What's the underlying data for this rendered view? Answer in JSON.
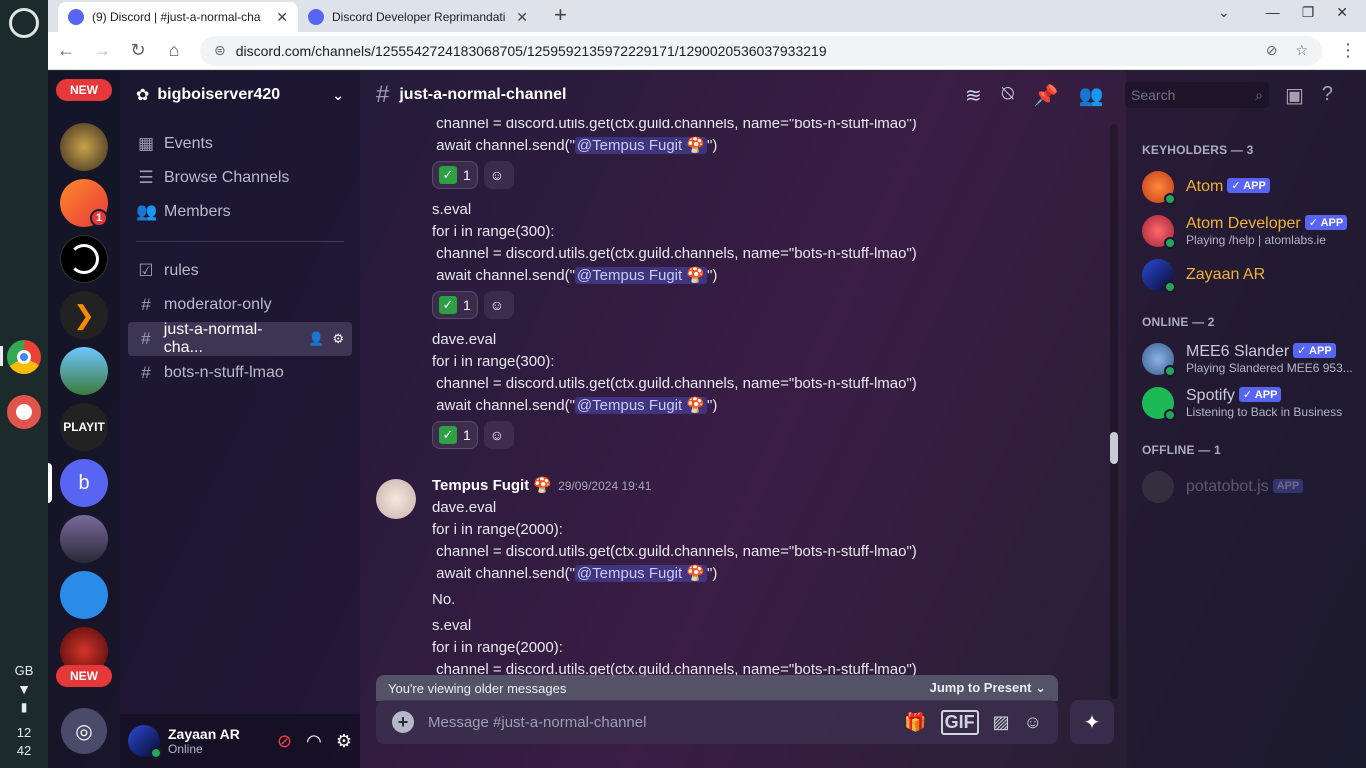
{
  "shelf": {
    "time_hours": "12",
    "time_minutes": "42",
    "keyboard": "GB"
  },
  "browser": {
    "tabs": [
      {
        "title": "(9) Discord | #just-a-normal-cha"
      },
      {
        "title": "Discord Developer Reprimandati"
      }
    ],
    "url": "discord.com/channels/1255542724183068705/1259592135972229171/1290020536037933219"
  },
  "guilds": {
    "new_label_top": "NEW",
    "new_label_bottom": "NEW",
    "notif_count": "1",
    "playit_label": "PLAYIT",
    "letter_server": "b"
  },
  "channels": {
    "server_name": "bigboiserver420",
    "top_items": [
      {
        "label": "Events"
      },
      {
        "label": "Browse Channels"
      },
      {
        "label": "Members"
      }
    ],
    "items": [
      {
        "label": "rules"
      },
      {
        "label": "moderator-only"
      },
      {
        "label": "just-a-normal-cha..."
      },
      {
        "label": "bots-n-stuff-lmao"
      }
    ]
  },
  "user": {
    "name": "Zayaan AR",
    "status": "Online"
  },
  "chat": {
    "channel_name": "just-a-normal-channel",
    "search_placeholder": "Search",
    "lines": [
      {
        "text": "channel = discord.utils.get(ctx.guild.channels, name=\"bots-n-stuff-lmao\")"
      },
      {
        "pre": "await channel.send(\"",
        "mention": "@Tempus Fugit 🍄",
        "post": "\")"
      },
      {
        "text": "s.eval"
      },
      {
        "text": "for i in range(300):"
      },
      {
        "text": "channel = discord.utils.get(ctx.guild.channels, name=\"bots-n-stuff-lmao\")"
      },
      {
        "pre": "await channel.send(\"",
        "mention": "@Tempus Fugit 🍄",
        "post": "\")"
      },
      {
        "text": "dave.eval"
      },
      {
        "text": "for i in range(300):"
      },
      {
        "text": "channel = discord.utils.get(ctx.guild.channels, name=\"bots-n-stuff-lmao\")"
      },
      {
        "pre": "await channel.send(\"",
        "mention": "@Tempus Fugit 🍄",
        "post": "\")"
      },
      {
        "text": "dave.eval"
      },
      {
        "text": "for i in range(2000):"
      },
      {
        "text": "channel = discord.utils.get(ctx.guild.channels, name=\"bots-n-stuff-lmao\")"
      },
      {
        "pre": "await channel.send(\"",
        "mention": "@Tempus Fugit 🍄",
        "post": "\")"
      },
      {
        "text": "No."
      },
      {
        "text": "s.eval"
      },
      {
        "text": "for i in range(2000):"
      },
      {
        "text": "channel = discord.utils.get(ctx.guild.channels, name=\"bots-n-stuff-lmao\")"
      }
    ],
    "reaction_count": "1",
    "message_author": "Tempus Fugit 🍄",
    "message_timestamp": "29/09/2024 19:41",
    "older_notice": "You're viewing older messages",
    "jump_label": "Jump to Present",
    "composer_placeholder": "Message #just-a-normal-channel",
    "gif_label": "GIF"
  },
  "members": {
    "groups": [
      {
        "heading": "KEYHOLDERS — 3",
        "people": [
          {
            "name": "Atom",
            "badge": "✓ APP",
            "sub": ""
          },
          {
            "name": "Atom Developer",
            "badge": "✓ APP",
            "sub": "Playing /help | atomlabs.ie"
          },
          {
            "name": "Zayaan AR",
            "badge": "",
            "sub": ""
          }
        ]
      },
      {
        "heading": "ONLINE — 2",
        "people": [
          {
            "name": "MEE6 Slander",
            "badge": "✓ APP",
            "sub": "Playing Slandered MEE6 953..."
          },
          {
            "name": "Spotify",
            "badge": "✓ APP",
            "sub": "Listening to Back in Business"
          }
        ]
      },
      {
        "heading": "OFFLINE — 1",
        "people": [
          {
            "name": "potatobot.js",
            "badge": "APP",
            "sub": ""
          }
        ]
      }
    ]
  },
  "colors": {
    "keyholder_name": "#f0b232",
    "app_badge": "#5865f2",
    "online_dot": "#23a55a",
    "new_pill": "#e5383b"
  }
}
